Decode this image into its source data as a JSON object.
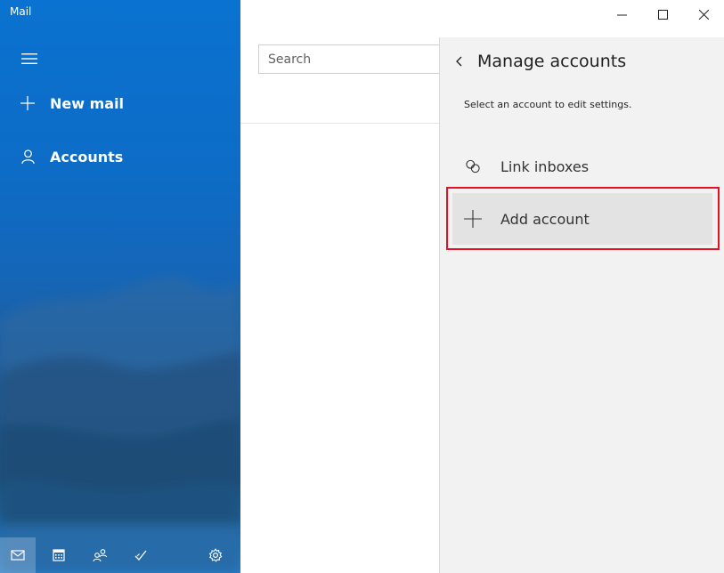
{
  "app": {
    "title": "Mail"
  },
  "nav": {
    "new_mail_label": "New mail",
    "accounts_label": "Accounts",
    "bottom_buttons": [
      "mail-icon",
      "calendar-icon",
      "people-icon",
      "todo-icon",
      "settings-icon"
    ]
  },
  "search": {
    "placeholder": "Search"
  },
  "panel": {
    "title": "Manage accounts",
    "subtitle": "Select an account to edit settings.",
    "items": [
      {
        "label": "Link inboxes",
        "icon": "link-icon"
      },
      {
        "label": "Add account",
        "icon": "plus-icon"
      }
    ]
  },
  "colors": {
    "nav_blue": "#0a72d0",
    "panel_bg": "#f2f2f2",
    "highlight": "#e81123"
  }
}
